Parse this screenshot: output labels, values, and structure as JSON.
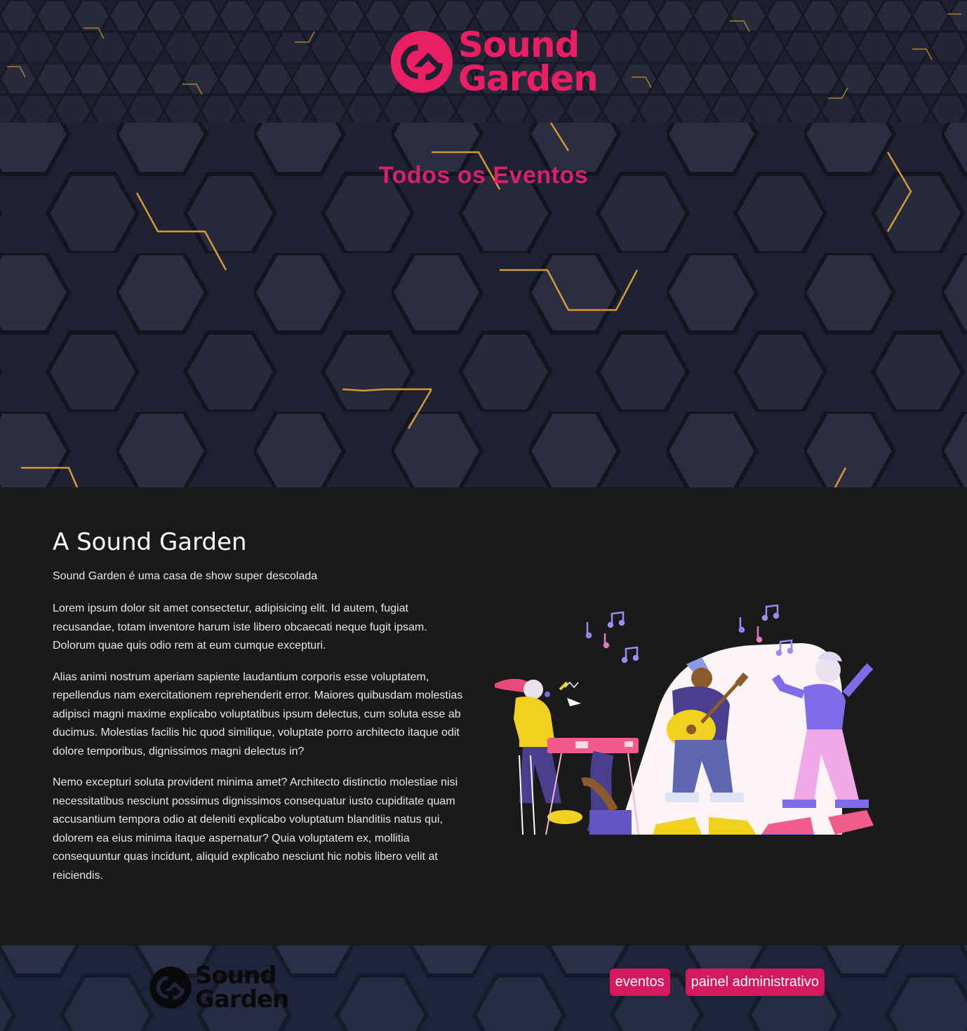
{
  "header": {
    "logo_line1": "Sound",
    "logo_line2": "Garden"
  },
  "hero": {
    "title": "Todos os Eventos"
  },
  "about": {
    "title": "A Sound Garden",
    "subtitle": "Sound Garden é uma casa de show super descolada",
    "paragraphs": [
      "Lorem ipsum dolor sit amet consectetur, adipisicing elit. Id autem, fugiat recusandae, totam inventore harum iste libero obcaecati neque fugit ipsam. Dolorum quae quis odio rem at eum cumque excepturi.",
      "Alias animi nostrum aperiam sapiente laudantium corporis esse voluptatem, repellendus nam exercitationem reprehenderit error. Maiores quibusdam molestias adipisci magni maxime explicabo voluptatibus ipsum delectus, cum soluta esse ab ducimus. Molestias facilis hic quod similique, voluptate porro architecto itaque odit dolore temporibus, dignissimos magni delectus in?",
      "Nemo excepturi soluta provident minima amet? Architecto distinctio molestiae nisi necessitatibus nesciunt possimus dignissimos consequatur iusto cupiditate quam accusantium tempora odio at deleniti explicabo voluptatum blanditiis natus qui, dolorem ea eius minima itaque aspernatur? Quia voluptatem ex, mollitia consequuntur quas incidunt, aliquid explicabo nesciunt hic nobis libero velit at reiciendis."
    ]
  },
  "footer": {
    "logo_line1": "Sound",
    "logo_line2": "Garden",
    "nav": [
      {
        "label": "eventos"
      },
      {
        "label": "painel administrativo"
      }
    ]
  },
  "colors": {
    "brand": "#e91e63",
    "button": "#d6185e",
    "about_bg": "#1a1a1a",
    "hex_dark": "#1f2232",
    "hex_gold": "#c8902e"
  },
  "icons": [
    "sound-garden-logo-icon",
    "music-note-icon"
  ]
}
